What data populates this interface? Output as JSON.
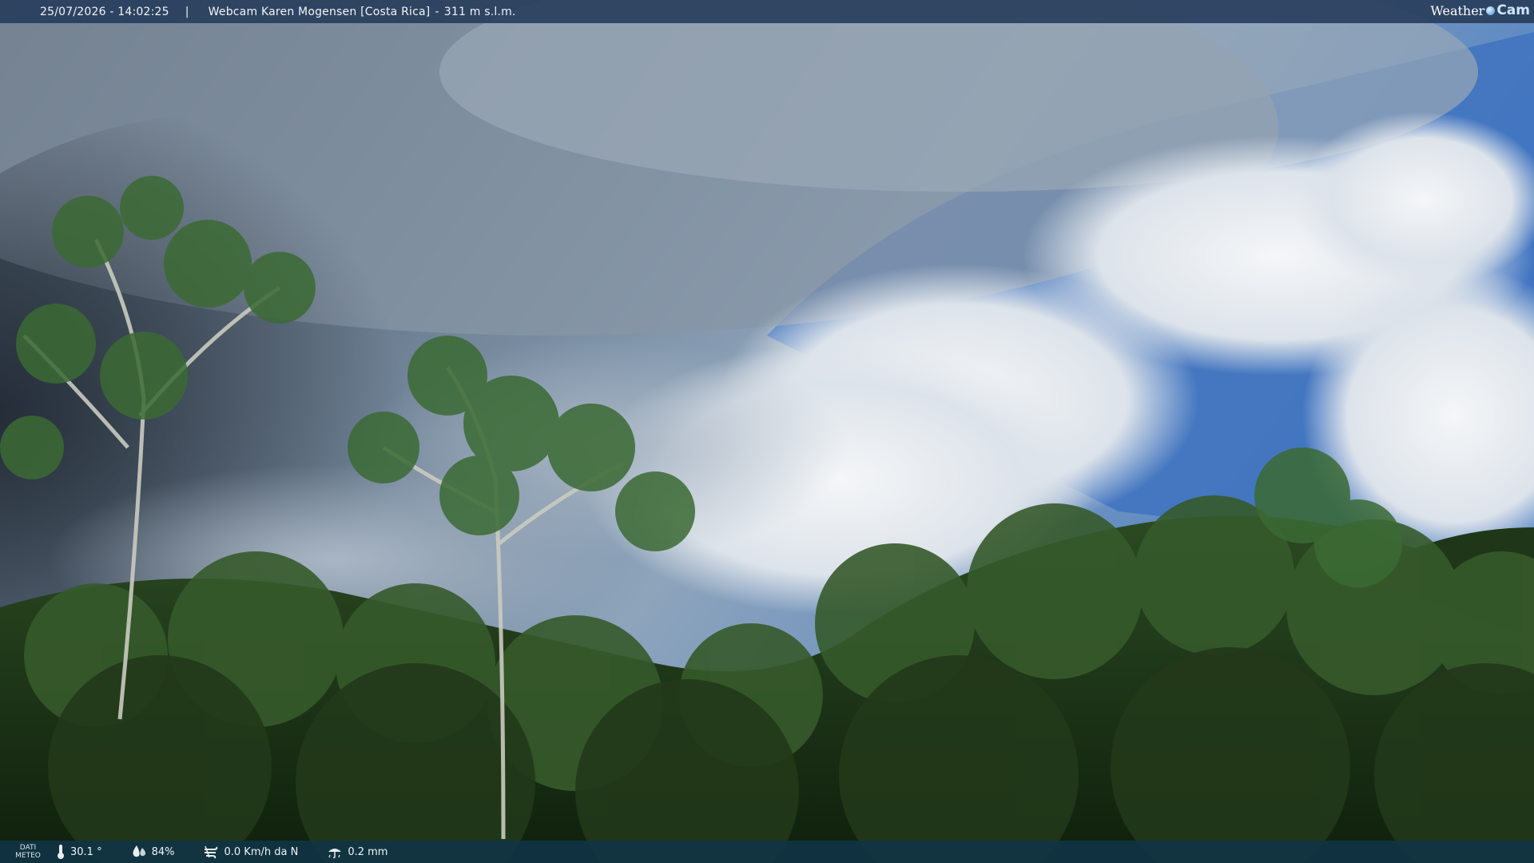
{
  "header": {
    "timestamp": "25/07/2026 - 14:02:25",
    "separator": "|",
    "webcam_name": "Webcam Karen Mogensen [Costa Rica]",
    "dash": "-",
    "altitude": "311 m s.l.m."
  },
  "brand": {
    "weather": "Weather",
    "cam": "Cam"
  },
  "footer": {
    "label_line1": "DATI",
    "label_line2": "METEO",
    "temperature": "30.1 °",
    "humidity": "84%",
    "wind": "0.0 Km/h da N",
    "rain": "0.2 mm"
  },
  "icons": {
    "temperature": "thermometer-icon",
    "humidity": "humidity-drop-icon",
    "wind": "wind-icon",
    "rain": "rain-icon"
  }
}
